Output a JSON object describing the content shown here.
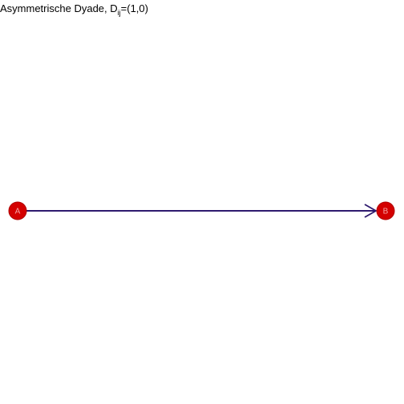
{
  "title": {
    "main": "Asymmetrische Dyade, D",
    "subscript": "ij",
    "suffix": "=(1,0)"
  },
  "nodes": [
    {
      "id": "A",
      "label": "A"
    },
    {
      "id": "B",
      "label": "B"
    }
  ],
  "edges": [
    {
      "from": "A",
      "to": "B",
      "directed": true
    }
  ],
  "colors": {
    "node_fill": "#d40000",
    "node_stroke": "#b00000",
    "node_label": "#f4a6a6",
    "edge": "#2e1a6e"
  }
}
